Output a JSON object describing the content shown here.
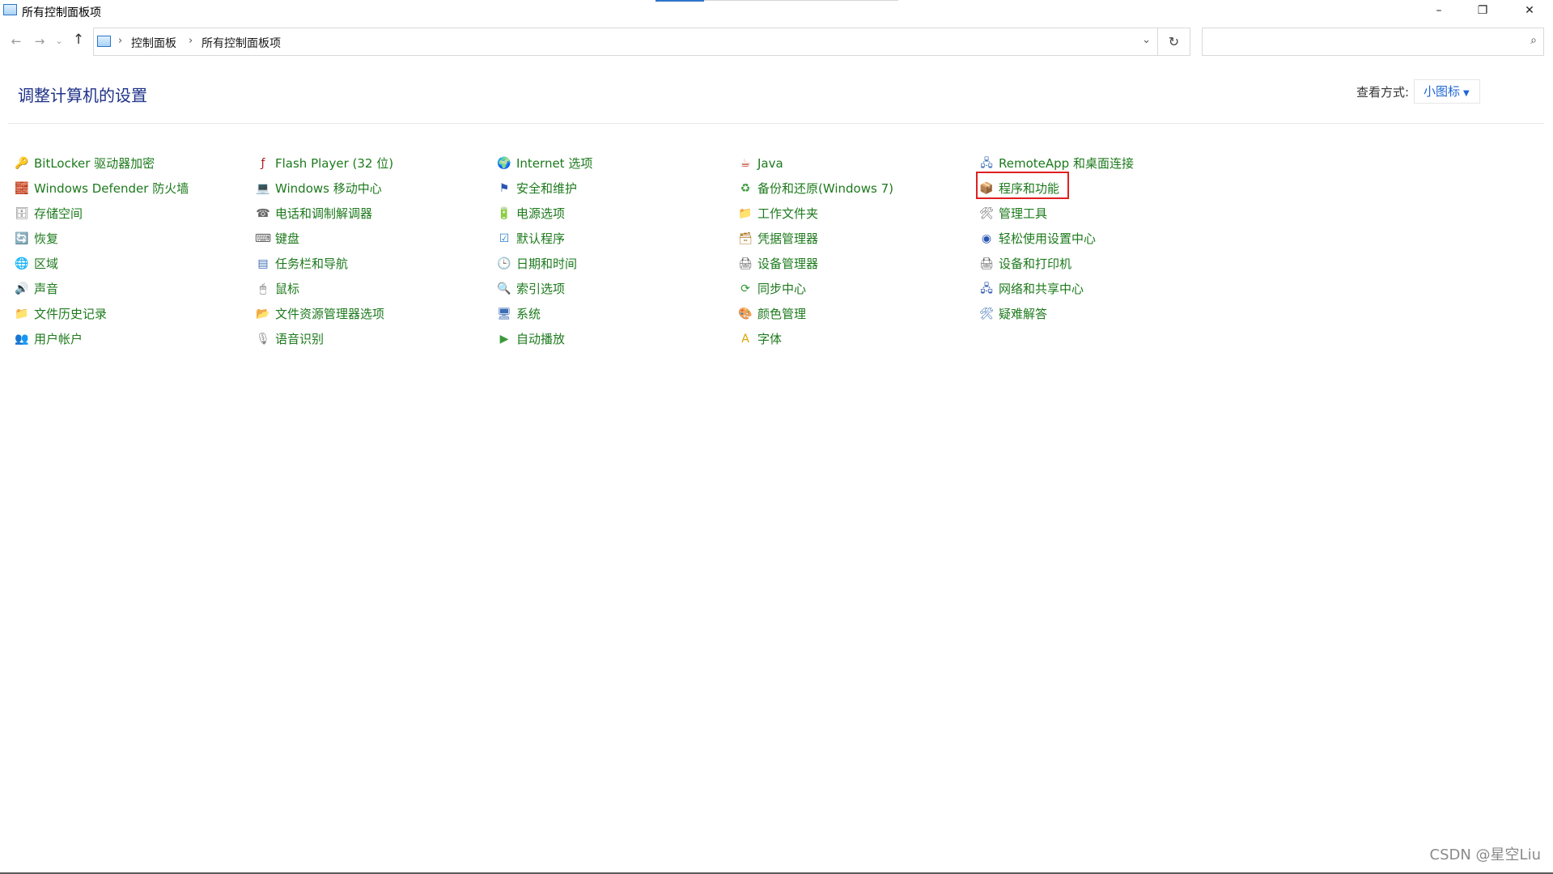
{
  "window": {
    "title": "所有控制面板项",
    "minimize_glyph": "–",
    "maximize_glyph": "❐",
    "close_glyph": "✕"
  },
  "nav": {
    "back_glyph": "←",
    "forward_glyph": "→",
    "recent_glyph": "⌄",
    "up_glyph": "↑",
    "breadcrumb": [
      "控制面板",
      "所有控制面板项"
    ],
    "crumb_sep": "›",
    "dropdown_glyph": "⌄",
    "refresh_glyph": "↻",
    "search_value": "",
    "search_glyph": "⌕"
  },
  "header": {
    "title": "调整计算机的设置",
    "view_by_label": "查看方式:",
    "view_by_value": "小图标",
    "view_by_caret": "▼"
  },
  "columns": [
    [
      {
        "label": "BitLocker 驱动器加密",
        "icon": "key-icon",
        "glyph": "🔑",
        "color": "#888888"
      },
      {
        "label": "Windows Defender 防火墙",
        "icon": "firewall-icon",
        "glyph": "🧱",
        "color": "#a8472b"
      },
      {
        "label": "存储空间",
        "icon": "storage-icon",
        "glyph": "🗄",
        "color": "#777777"
      },
      {
        "label": "恢复",
        "icon": "recovery-icon",
        "glyph": "🔄",
        "color": "#2f8f4a"
      },
      {
        "label": "区域",
        "icon": "region-icon",
        "glyph": "🌐",
        "color": "#2a6fb0"
      },
      {
        "label": "声音",
        "icon": "sound-icon",
        "glyph": "🔊",
        "color": "#777777"
      },
      {
        "label": "文件历史记录",
        "icon": "file-history-icon",
        "glyph": "📁",
        "color": "#d9a400"
      },
      {
        "label": "用户帐户",
        "icon": "user-accounts-icon",
        "glyph": "👥",
        "color": "#4a7bb0"
      }
    ],
    [
      {
        "label": "Flash Player (32 位)",
        "icon": "flash-player-icon",
        "glyph": "ƒ",
        "color": "#b3191f"
      },
      {
        "label": "Windows 移动中心",
        "icon": "mobility-center-icon",
        "glyph": "💻",
        "color": "#3c6eb4"
      },
      {
        "label": "电话和调制解调器",
        "icon": "phone-modem-icon",
        "glyph": "☎",
        "color": "#666666"
      },
      {
        "label": "键盘",
        "icon": "keyboard-icon",
        "glyph": "⌨",
        "color": "#666666"
      },
      {
        "label": "任务栏和导航",
        "icon": "taskbar-icon",
        "glyph": "▤",
        "color": "#3c6eb4"
      },
      {
        "label": "鼠标",
        "icon": "mouse-icon",
        "glyph": "🖱",
        "color": "#555555"
      },
      {
        "label": "文件资源管理器选项",
        "icon": "folder-options-icon",
        "glyph": "📂",
        "color": "#d9a400"
      },
      {
        "label": "语音识别",
        "icon": "microphone-icon",
        "glyph": "🎙",
        "color": "#888888"
      }
    ],
    [
      {
        "label": "Internet 选项",
        "icon": "internet-options-icon",
        "glyph": "🌍",
        "color": "#2a8f5f"
      },
      {
        "label": "安全和维护",
        "icon": "flag-icon",
        "glyph": "⚑",
        "color": "#2a55b0"
      },
      {
        "label": "电源选项",
        "icon": "power-options-icon",
        "glyph": "🔋",
        "color": "#3a9a3a"
      },
      {
        "label": "默认程序",
        "icon": "default-programs-icon",
        "glyph": "☑",
        "color": "#2f7fcf"
      },
      {
        "label": "日期和时间",
        "icon": "date-time-icon",
        "glyph": "🕒",
        "color": "#4a88c8"
      },
      {
        "label": "索引选项",
        "icon": "indexing-icon",
        "glyph": "🔍",
        "color": "#666666"
      },
      {
        "label": "系统",
        "icon": "system-icon",
        "glyph": "🖥",
        "color": "#3c6eb4"
      },
      {
        "label": "自动播放",
        "icon": "autoplay-icon",
        "glyph": "▶",
        "color": "#3a9a3a"
      }
    ],
    [
      {
        "label": "Java",
        "icon": "java-icon",
        "glyph": "☕",
        "color": "#c0392b"
      },
      {
        "label": "备份和还原(Windows 7)",
        "icon": "backup-restore-icon",
        "glyph": "♻",
        "color": "#3a9a3a"
      },
      {
        "label": "工作文件夹",
        "icon": "work-folders-icon",
        "glyph": "📁",
        "color": "#d9a400"
      },
      {
        "label": "凭据管理器",
        "icon": "credential-manager-icon",
        "glyph": "🗃",
        "color": "#b07a2a"
      },
      {
        "label": "设备管理器",
        "icon": "device-manager-icon",
        "glyph": "🖨",
        "color": "#555555"
      },
      {
        "label": "同步中心",
        "icon": "sync-center-icon",
        "glyph": "⟳",
        "color": "#2f9a2f"
      },
      {
        "label": "颜色管理",
        "icon": "color-management-icon",
        "glyph": "🎨",
        "color": "#c04a8a"
      },
      {
        "label": "字体",
        "icon": "fonts-icon",
        "glyph": "A",
        "color": "#d9a400"
      }
    ],
    [
      {
        "label": "RemoteApp 和桌面连接",
        "icon": "remoteapp-icon",
        "glyph": "🖧",
        "color": "#3c6eb4"
      },
      {
        "label": "程序和功能",
        "icon": "programs-features-icon",
        "glyph": "📦",
        "color": "#777777"
      },
      {
        "label": "管理工具",
        "icon": "admin-tools-icon",
        "glyph": "🛠",
        "color": "#666666"
      },
      {
        "label": "轻松使用设置中心",
        "icon": "ease-of-access-icon",
        "glyph": "◉",
        "color": "#2a55b0"
      },
      {
        "label": "设备和打印机",
        "icon": "devices-printers-icon",
        "glyph": "🖨",
        "color": "#555555"
      },
      {
        "label": "网络和共享中心",
        "icon": "network-sharing-icon",
        "glyph": "🖧",
        "color": "#2a55b0"
      },
      {
        "label": "疑难解答",
        "icon": "troubleshooting-icon",
        "glyph": "🛠",
        "color": "#3c6eb4"
      }
    ]
  ],
  "watermark": "CSDN @星空Liu"
}
